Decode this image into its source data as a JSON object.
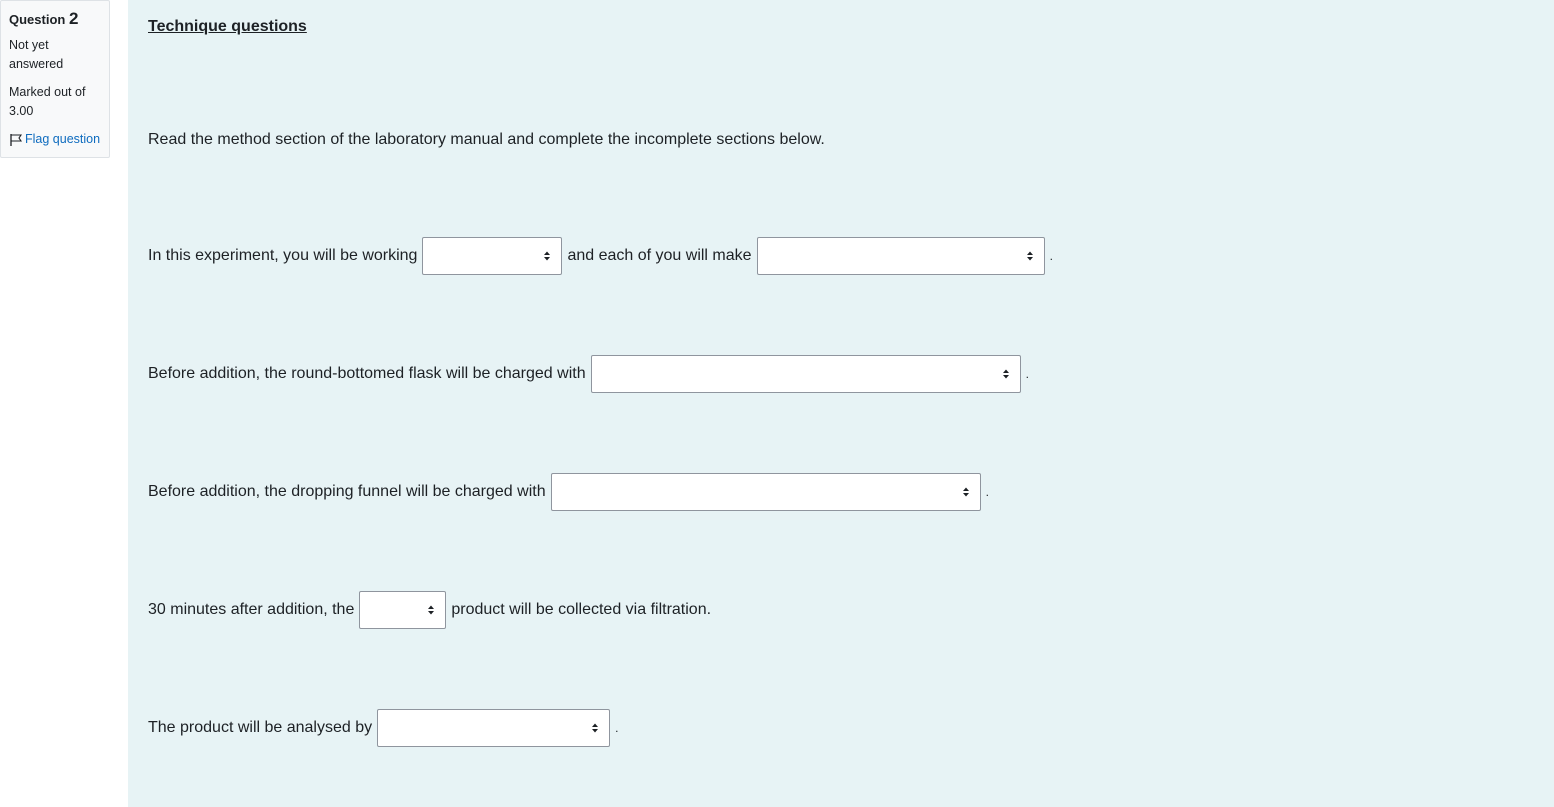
{
  "info": {
    "question_word": "Question",
    "question_number": "2",
    "state": "Not yet answered",
    "grade": "Marked out of 3.00",
    "flag_label": "Flag question"
  },
  "content": {
    "title": "Technique questions",
    "intro": "Read the method section of the laboratory manual and complete the incomplete sections below.",
    "lines": [
      {
        "part1": "In this experiment, you will be working",
        "part2": "and each of you will make",
        "end": "."
      },
      {
        "part1": "Before addition, the round-bottomed flask will be charged with",
        "end": "."
      },
      {
        "part1": "Before addition, the dropping funnel will be charged with",
        "end": "."
      },
      {
        "part1": "30 minutes after addition, the",
        "part2": "product will be collected via filtration."
      },
      {
        "part1": "The product will be analysed by",
        "end": "."
      }
    ],
    "selects": [
      {
        "value": ""
      },
      {
        "value": ""
      },
      {
        "value": ""
      },
      {
        "value": ""
      },
      {
        "value": ""
      },
      {
        "value": ""
      }
    ]
  }
}
